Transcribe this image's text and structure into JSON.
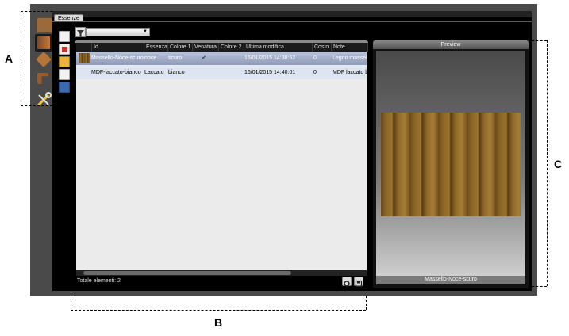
{
  "annotations": {
    "a": "A",
    "b": "B",
    "c": "C"
  },
  "tab": {
    "label": "Essenze"
  },
  "grid": {
    "columns": [
      "Id",
      "Essenza",
      "Colore 1",
      "Venatura",
      "Colore 2",
      "Ultima modifica",
      "Costo",
      "Note"
    ],
    "rows": [
      {
        "id": "Massello-Noce-scuro",
        "essenza": "noce",
        "colore1": "scuro",
        "venatura": "✔",
        "colore2": "",
        "ultima_modifica": "16/01/2015 14:38:52",
        "costo": "0",
        "note": "Legno massel"
      },
      {
        "id": "MDF-laccato-bianco",
        "essenza": "Laccato",
        "colore1": "bianco",
        "venatura": "",
        "colore2": "",
        "ultima_modifica": "16/01/2015 14:40:01",
        "costo": "0",
        "note": "MDF laccato b"
      }
    ],
    "footer": "Totale elementi: 2"
  },
  "preview": {
    "title": "Preview",
    "caption": "Massello-Noce-scuro"
  },
  "icons": {
    "left_sidebar": [
      "wood-panel-icon",
      "catalog-book-icon",
      "diamond-shape-icon",
      "profile-shape-icon",
      "tools-icon"
    ],
    "vertical_bar": [
      "new-item-icon",
      "delete-item-icon",
      "open-folder-icon",
      "copy-item-icon",
      "save-item-icon"
    ],
    "footer": [
      "refresh-icon",
      "save-icon"
    ]
  },
  "colors": {
    "selected_row": "#9ca8c4",
    "row_alt": "#dde6f0",
    "wood_brown": "#8a6424"
  }
}
